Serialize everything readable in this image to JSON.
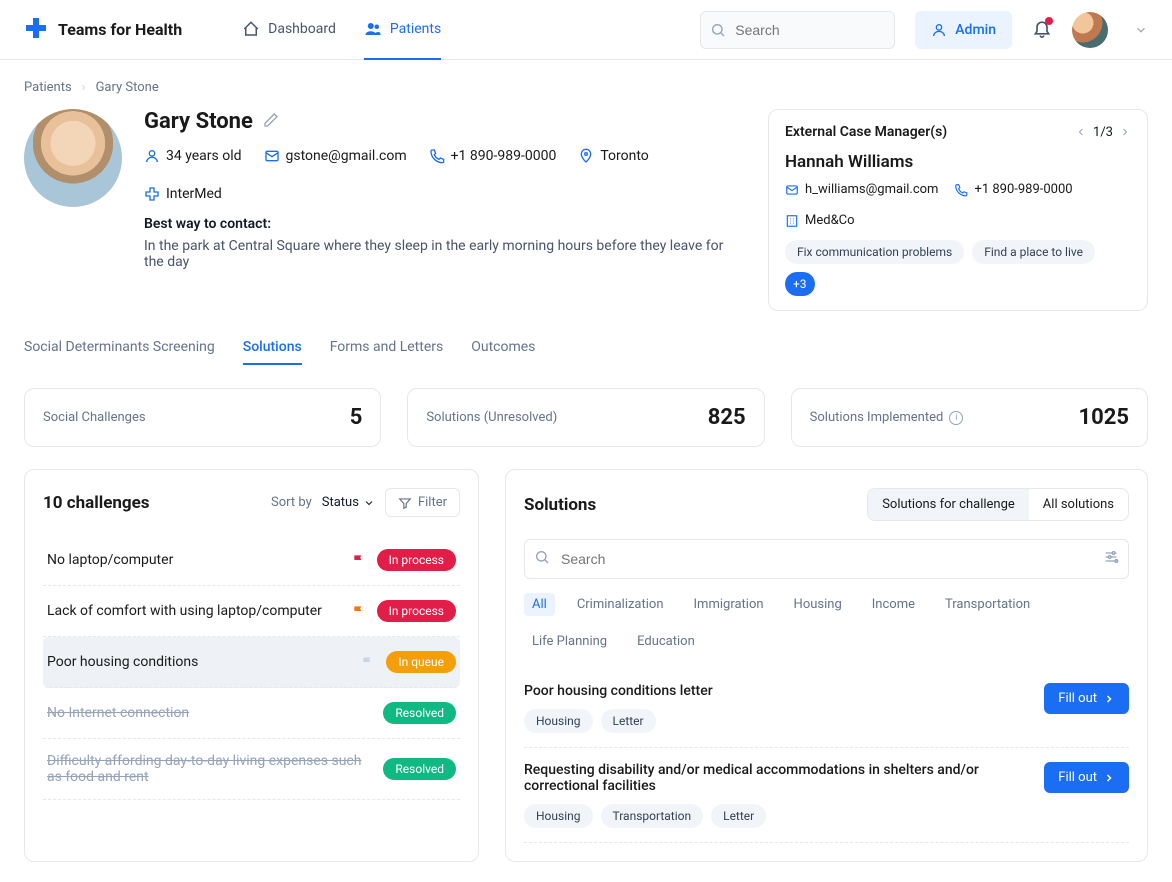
{
  "brand": "Teams for Health",
  "nav": {
    "dashboard": "Dashboard",
    "patients": "Patients"
  },
  "searchPlaceholder": "Search",
  "adminLabel": "Admin",
  "breadcrumb": {
    "root": "Patients",
    "current": "Gary Stone"
  },
  "patient": {
    "name": "Gary Stone",
    "age": "34 years old",
    "email": "gstone@gmail.com",
    "phone": "+1 890-989-0000",
    "city": "Toronto",
    "org": "InterMed",
    "contactLabel": "Best way to contact:",
    "contactText": "In the park at Central Square where they sleep in the early morning hours before they leave for the day"
  },
  "caseManager": {
    "title": "External Case Manager(s)",
    "pager": "1/3",
    "name": "Hannah Williams",
    "email": "h_williams@gmail.com",
    "phone": "+1 890-989-0000",
    "org": "Med&Co",
    "tag1": "Fix communication problems",
    "tag2": "Find a place to live",
    "more": "+3"
  },
  "subtabs": {
    "sds": "Social Determinants Screening",
    "solutions": "Solutions",
    "forms": "Forms and Letters",
    "outcomes": "Outcomes"
  },
  "stats": {
    "challengesLabel": "Social Challenges",
    "challengesVal": "5",
    "unresolvedLabel": "Solutions (Unresolved)",
    "unresolvedVal": "825",
    "implLabel": "Solutions Implemented",
    "implVal": "1025"
  },
  "challengePane": {
    "title": "10 challenges",
    "sortBy": "Sort by",
    "sortField": "Status",
    "filter": "Filter",
    "rows": [
      {
        "text": "No laptop/computer",
        "status": "In process",
        "statusClass": "process",
        "flag": "red"
      },
      {
        "text": "Lack of comfort with using laptop/computer",
        "status": "In process",
        "statusClass": "process",
        "flag": "orange"
      },
      {
        "text": "Poor housing conditions",
        "status": "In queue",
        "statusClass": "queue",
        "flag": "gray",
        "selected": true
      },
      {
        "text": "No Internet connection",
        "status": "Resolved",
        "statusClass": "resolved",
        "strike": true
      },
      {
        "text": "Difficulty affording day-to-day living expenses such as food and rent",
        "status": "Resolved",
        "statusClass": "resolved",
        "strike": true
      }
    ]
  },
  "solutionsPane": {
    "title": "Solutions",
    "segA": "Solutions for challenge",
    "segB": "All solutions",
    "searchPlaceholder": "Search",
    "cats": [
      "All",
      "Criminalization",
      "Immigration",
      "Housing",
      "Income",
      "Transportation",
      "Life Planning",
      "Education"
    ],
    "fillOut": "Fill out",
    "items": [
      {
        "title": "Poor housing conditions letter",
        "tags": [
          "Housing",
          "Letter"
        ]
      },
      {
        "title": "Requesting disability and/or medical accommodations in shelters and/or correctional facilities",
        "tags": [
          "Housing",
          "Transportation",
          "Letter"
        ]
      }
    ]
  }
}
